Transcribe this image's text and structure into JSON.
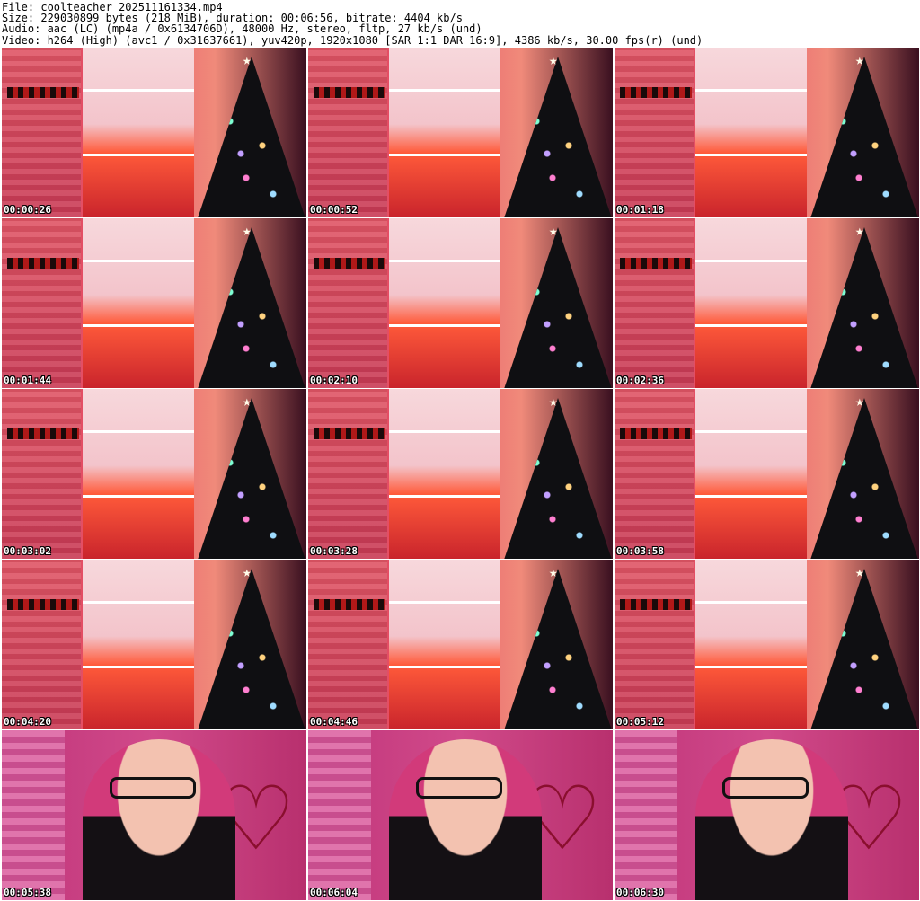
{
  "header": {
    "file": "File: coolteacher_202511161334.mp4",
    "size": "Size: 229030899 bytes (218 MiB), duration: 00:06:56, bitrate: 4404 kb/s",
    "audio": "Audio: aac (LC) (mp4a / 0x6134706D), 48000 Hz, stereo, fltp, 27 kb/s (und)",
    "video": "Video: h264 (High) (avc1 / 0x31637661), yuv420p, 1920x1080 [SAR 1:1 DAR 16:9], 4386 kb/s, 30.00 fps(r) (und)"
  },
  "thumbnails": [
    {
      "time": "00:00:26",
      "scene": "room"
    },
    {
      "time": "00:00:52",
      "scene": "room"
    },
    {
      "time": "00:01:18",
      "scene": "room"
    },
    {
      "time": "00:01:44",
      "scene": "room"
    },
    {
      "time": "00:02:10",
      "scene": "room"
    },
    {
      "time": "00:02:36",
      "scene": "room"
    },
    {
      "time": "00:03:02",
      "scene": "room"
    },
    {
      "time": "00:03:28",
      "scene": "room"
    },
    {
      "time": "00:03:58",
      "scene": "room"
    },
    {
      "time": "00:04:20",
      "scene": "room"
    },
    {
      "time": "00:04:46",
      "scene": "room"
    },
    {
      "time": "00:05:12",
      "scene": "room"
    },
    {
      "time": "00:05:38",
      "scene": "face"
    },
    {
      "time": "00:06:04",
      "scene": "face"
    },
    {
      "time": "00:06:30",
      "scene": "face"
    }
  ]
}
